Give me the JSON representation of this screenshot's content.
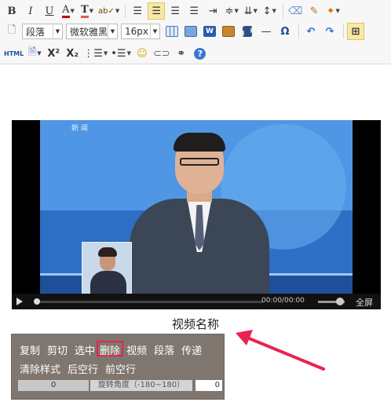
{
  "toolbar": {
    "row1": [
      "B",
      "I",
      "U",
      "A",
      "T",
      "ab✓"
    ],
    "paragraph": "段落",
    "font_family": "微软雅黑",
    "font_size": "16px",
    "html_label": "HTML",
    "superscript": "X²",
    "subscript": "X₂",
    "omega": "Ω",
    "help": "?",
    "colors": {
      "accent": "#f7e8a7",
      "link_blue": "#1a4f99"
    }
  },
  "video": {
    "channel": "新 闻",
    "time": "00:00/00:00",
    "fullscreen": "全屏"
  },
  "caption": "视频名称",
  "popup": {
    "row1": [
      "复制",
      "剪切",
      "选中",
      "删除",
      "视频",
      "段落",
      "传递"
    ],
    "row2": [
      "清除样式",
      "后空行",
      "前空行"
    ],
    "rotation_left": "0",
    "rotation_label": "旋转角度（-180~180）",
    "rotation_right": "0",
    "highlight_color": "#e8234f"
  }
}
